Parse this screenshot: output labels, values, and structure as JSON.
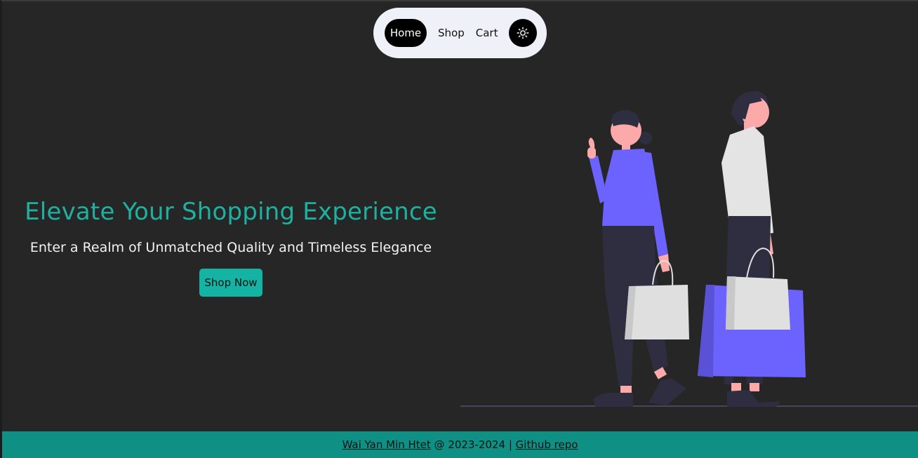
{
  "nav": {
    "home_label": "Home",
    "shop_label": "Shop",
    "cart_label": "Cart",
    "theme_toggle_icon": "sun-icon"
  },
  "hero": {
    "title": "Elevate Your Shopping Experience",
    "subtitle": "Enter a Realm of Unmatched Quality and Timeless Elegance",
    "cta_label": "Shop Now"
  },
  "illustration": {
    "name": "shoppers-illustration"
  },
  "footer": {
    "author_link": "Wai Yan Min Htet",
    "middle_text": " @ 2023-2024 | ",
    "repo_link": "Github repo"
  },
  "colors": {
    "background": "#262626",
    "accent": "#14b3a3",
    "title": "#1fb0a0",
    "footer": "#0e9184",
    "purple": "#6c63ff"
  }
}
